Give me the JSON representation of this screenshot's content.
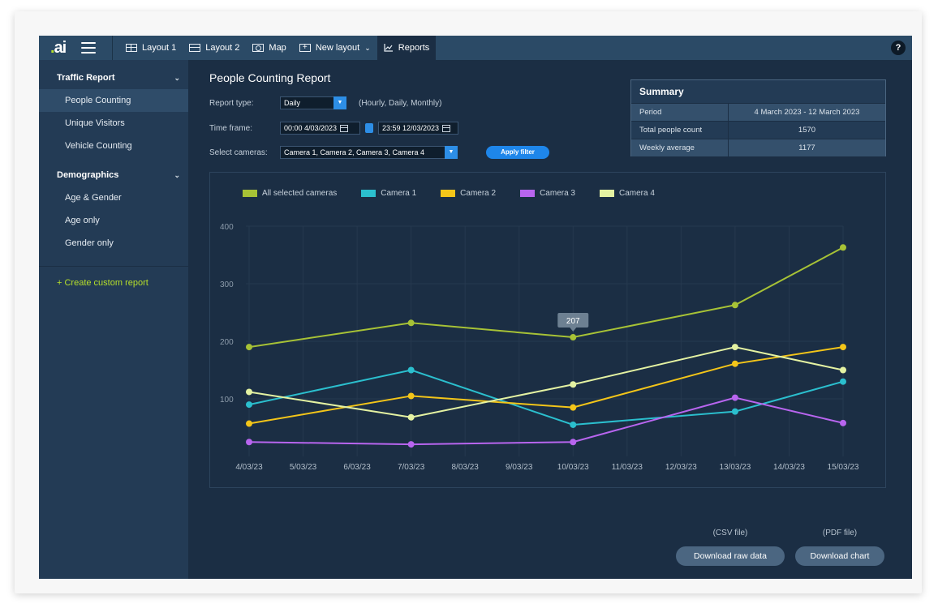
{
  "topbar": {
    "logo": ".ai",
    "tabs": [
      {
        "label": "Layout 1",
        "icon": "grid-layout-icon"
      },
      {
        "label": "Layout 2",
        "icon": "split-layout-icon"
      },
      {
        "label": "Map",
        "icon": "map-icon"
      },
      {
        "label": "New layout",
        "icon": "plus-box-icon"
      },
      {
        "label": "Reports",
        "icon": "chart-icon"
      }
    ],
    "new_layout_chevron": "⌄",
    "help": "?"
  },
  "sidebar": {
    "groups": [
      {
        "label": "Traffic Report",
        "items": [
          "People Counting",
          "Unique Visitors",
          "Vehicle Counting"
        ]
      },
      {
        "label": "Demographics",
        "items": [
          "Age & Gender",
          "Age only",
          "Gender only"
        ]
      }
    ],
    "active_item": "People Counting",
    "create": "+ Create custom report"
  },
  "report": {
    "title": "People Counting Report",
    "report_type_label": "Report type:",
    "report_type_value": "Daily",
    "report_type_hint": "(Hourly, Daily, Monthly)",
    "time_frame_label": "Time frame:",
    "time_from": "00:00 4/03/2023",
    "time_to": "23:59 12/03/2023",
    "cameras_label": "Select cameras:",
    "cameras_value": "Camera 1, Camera 2, Camera 3, Camera 4",
    "apply_button": "Apply filter"
  },
  "summary": {
    "title": "Summary",
    "rows": [
      {
        "key": "Period",
        "value": "4 March 2023 - 12 March 2023"
      },
      {
        "key": "Total people count",
        "value": "1570"
      },
      {
        "key": "Weekly average",
        "value": "1177"
      }
    ]
  },
  "chart_data": {
    "type": "line",
    "categories": [
      "4/03/23",
      "5/03/23",
      "6/03/23",
      "7/03/23",
      "8/03/23",
      "9/03/23",
      "10/03/23",
      "11/03/23",
      "12/03/23",
      "13/03/23",
      "14/03/23",
      "15/03/23"
    ],
    "yticks": [
      100,
      200,
      300,
      400
    ],
    "ylim": [
      0,
      400
    ],
    "legend_position": "top-left",
    "grid": true,
    "tooltip": {
      "series": "All selected cameras",
      "category": "10/03/23",
      "label": "207"
    },
    "series": [
      {
        "name": "All selected cameras",
        "color": "#a7c236",
        "points": [
          [
            "4/03/23",
            190
          ],
          [
            "7/03/23",
            232
          ],
          [
            "10/03/23",
            207
          ],
          [
            "13/03/23",
            263
          ],
          [
            "15/03/23",
            363
          ]
        ]
      },
      {
        "name": "Camera 1",
        "color": "#2bbfce",
        "points": [
          [
            "4/03/23",
            90
          ],
          [
            "7/03/23",
            150
          ],
          [
            "10/03/23",
            55
          ],
          [
            "13/03/23",
            78
          ],
          [
            "15/03/23",
            130
          ]
        ]
      },
      {
        "name": "Camera 2",
        "color": "#f3c519",
        "points": [
          [
            "4/03/23",
            57
          ],
          [
            "7/03/23",
            105
          ],
          [
            "10/03/23",
            85
          ],
          [
            "13/03/23",
            161
          ],
          [
            "15/03/23",
            190
          ]
        ]
      },
      {
        "name": "Camera 3",
        "color": "#b865ef",
        "points": [
          [
            "4/03/23",
            25
          ],
          [
            "7/03/23",
            21
          ],
          [
            "10/03/23",
            25
          ],
          [
            "13/03/23",
            102
          ],
          [
            "15/03/23",
            58
          ]
        ]
      },
      {
        "name": "Camera 4",
        "color": "#e4f2a2",
        "points": [
          [
            "4/03/23",
            112
          ],
          [
            "7/03/23",
            68
          ],
          [
            "10/03/23",
            125
          ],
          [
            "13/03/23",
            190
          ],
          [
            "15/03/23",
            150
          ]
        ]
      }
    ]
  },
  "downloads": [
    {
      "label": "(CSV file)",
      "button": "Download raw data"
    },
    {
      "label": "(PDF file)",
      "button": "Download chart"
    }
  ]
}
